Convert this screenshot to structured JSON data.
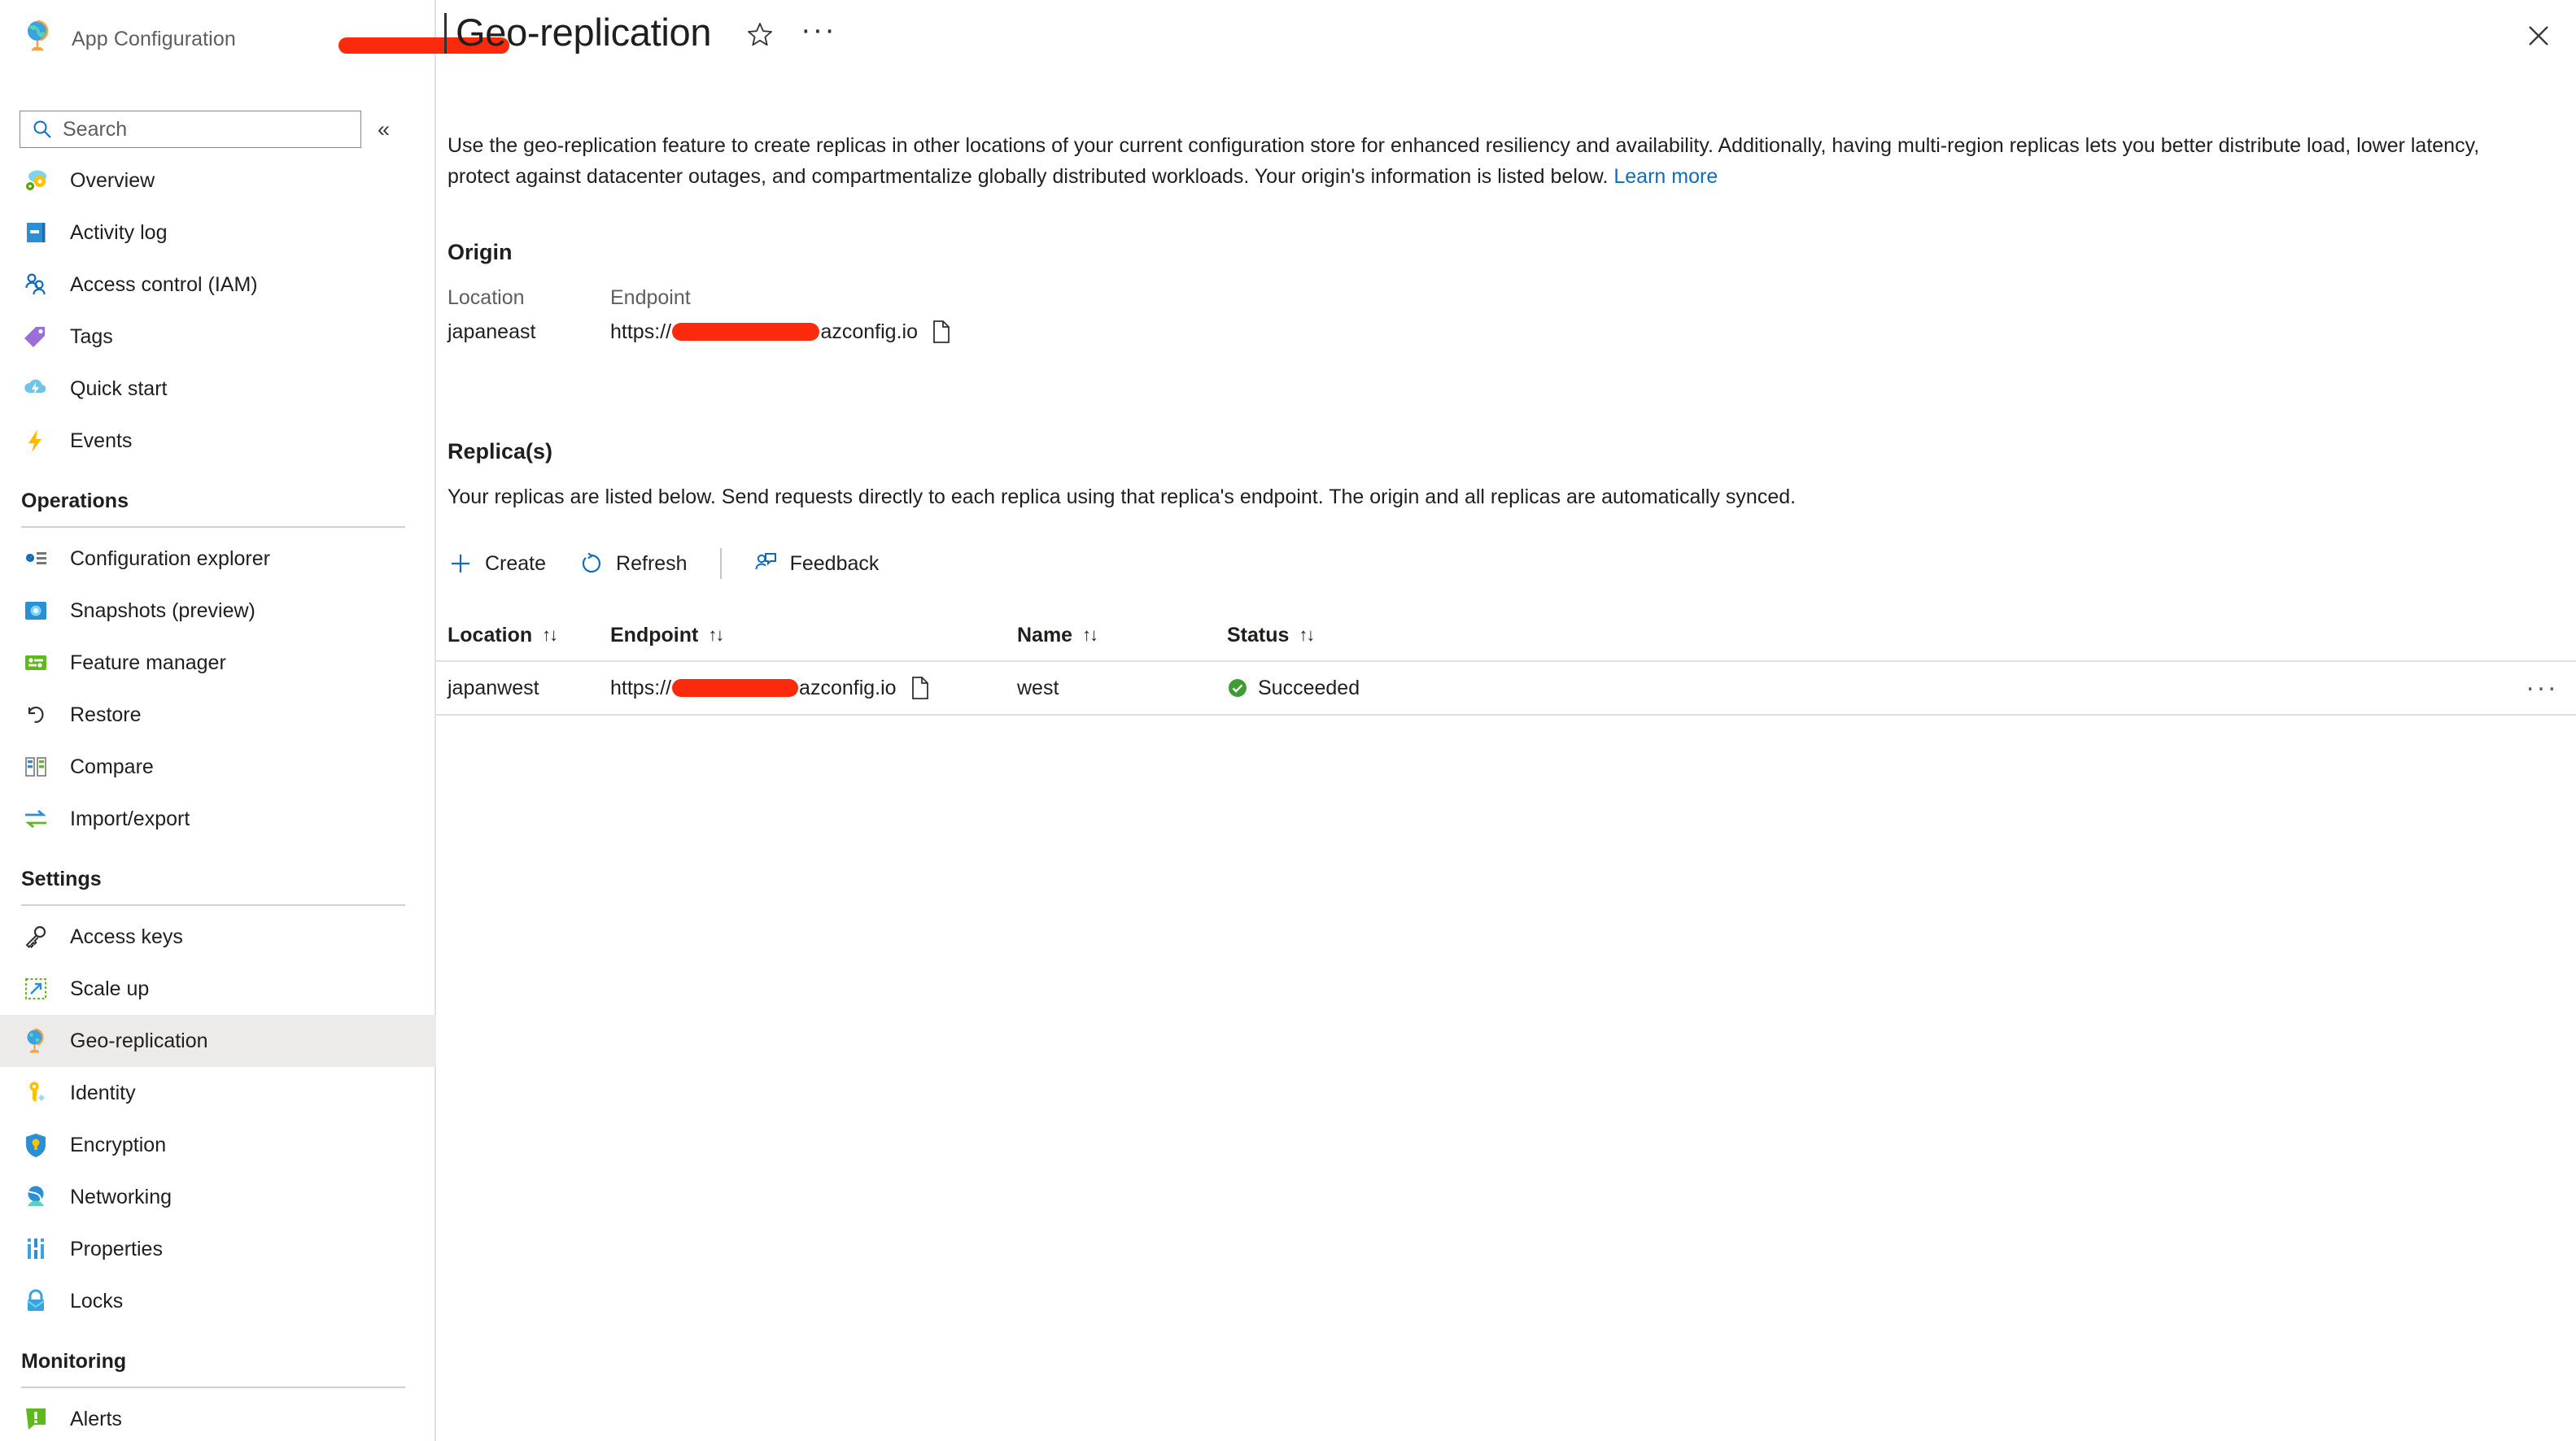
{
  "resource": {
    "type_label": "App Configuration",
    "name_redacted": true
  },
  "search": {
    "placeholder": "Search"
  },
  "sidebar": {
    "collapse_label": "«",
    "items": [
      {
        "label": "Overview",
        "icon": "overview-icon"
      },
      {
        "label": "Activity log",
        "icon": "activity-log-icon"
      },
      {
        "label": "Access control (IAM)",
        "icon": "access-control-icon"
      },
      {
        "label": "Tags",
        "icon": "tags-icon"
      },
      {
        "label": "Quick start",
        "icon": "quick-start-icon"
      },
      {
        "label": "Events",
        "icon": "events-icon"
      }
    ],
    "groups": [
      {
        "title": "Operations",
        "items": [
          {
            "label": "Configuration explorer",
            "icon": "configuration-explorer-icon"
          },
          {
            "label": "Snapshots (preview)",
            "icon": "snapshots-icon"
          },
          {
            "label": "Feature manager",
            "icon": "feature-manager-icon"
          },
          {
            "label": "Restore",
            "icon": "restore-icon"
          },
          {
            "label": "Compare",
            "icon": "compare-icon"
          },
          {
            "label": "Import/export",
            "icon": "import-export-icon"
          }
        ]
      },
      {
        "title": "Settings",
        "items": [
          {
            "label": "Access keys",
            "icon": "access-keys-icon"
          },
          {
            "label": "Scale up",
            "icon": "scale-up-icon"
          },
          {
            "label": "Geo-replication",
            "icon": "geo-replication-icon",
            "active": true
          },
          {
            "label": "Identity",
            "icon": "identity-icon"
          },
          {
            "label": "Encryption",
            "icon": "encryption-icon"
          },
          {
            "label": "Networking",
            "icon": "networking-icon"
          },
          {
            "label": "Properties",
            "icon": "properties-icon"
          },
          {
            "label": "Locks",
            "icon": "locks-icon"
          }
        ]
      },
      {
        "title": "Monitoring",
        "items": [
          {
            "label": "Alerts",
            "icon": "alerts-icon"
          }
        ]
      }
    ]
  },
  "header": {
    "title": "Geo-replication",
    "favorite_icon": "star-icon",
    "more_icon": "ellipsis-icon",
    "close_icon": "close-icon"
  },
  "main": {
    "description": "Use the geo-replication feature to create replicas in other locations of your current configuration store for enhanced resiliency and availability. Additionally, having multi-region replicas lets you better distribute load, lower latency, protect against datacenter outages, and compartmentalize globally distributed workloads. Your origin's information is listed below. ",
    "learn_more": "Learn more",
    "origin": {
      "title": "Origin",
      "headers": {
        "location": "Location",
        "endpoint": "Endpoint"
      },
      "location": "japaneast",
      "endpoint_prefix": "https://",
      "endpoint_suffix": "azconfig.io",
      "copy_icon": "copy-icon"
    },
    "replicas": {
      "title": "Replica(s)",
      "description": "Your replicas are listed below. Send requests directly to each replica using that replica's endpoint. The origin and all replicas are automatically synced.",
      "toolbar": {
        "create_label": "Create",
        "refresh_label": "Refresh",
        "feedback_label": "Feedback"
      },
      "columns": [
        "Location",
        "Endpoint",
        "Name",
        "Status"
      ],
      "sort_glyph": "↑↓",
      "rows": [
        {
          "location": "japanwest",
          "endpoint_prefix": "https://",
          "endpoint_suffix": "azconfig.io",
          "name": "west",
          "status": "Succeeded",
          "status_color": "#3f9c35"
        }
      ]
    }
  },
  "colors": {
    "accent": "#0f6cbd",
    "redaction": "#fc2a0c",
    "success": "#3f9c35",
    "selected_bg": "#edebe9"
  }
}
